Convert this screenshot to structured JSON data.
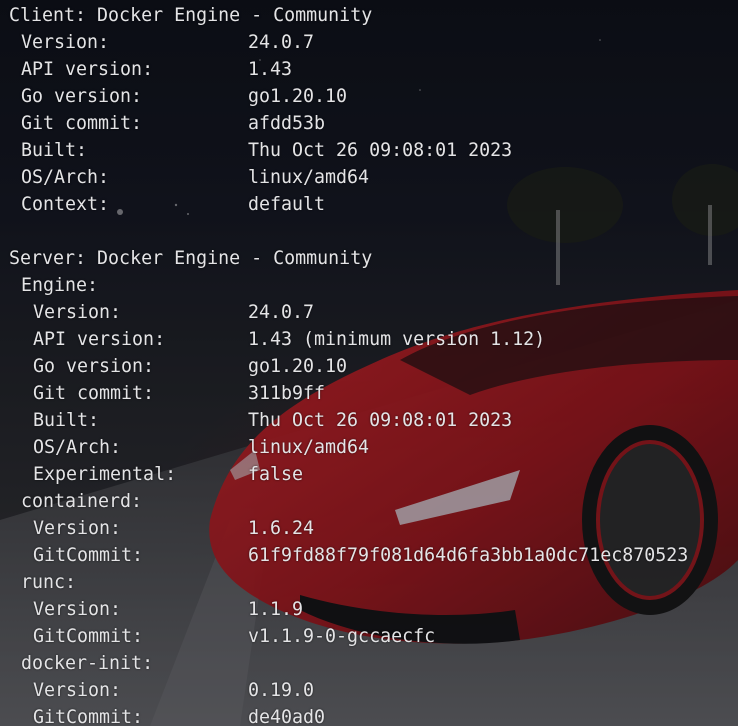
{
  "client": {
    "heading": "Client: Docker Engine - Community",
    "fields": [
      {
        "key": "Version:",
        "value": "24.0.7"
      },
      {
        "key": "API version:",
        "value": "1.43"
      },
      {
        "key": "Go version:",
        "value": "go1.20.10"
      },
      {
        "key": "Git commit:",
        "value": "afdd53b"
      },
      {
        "key": "Built:",
        "value": "Thu Oct 26 09:08:01 2023"
      },
      {
        "key": "OS/Arch:",
        "value": "linux/amd64"
      },
      {
        "key": "Context:",
        "value": "default"
      }
    ]
  },
  "server": {
    "heading": "Server: Docker Engine - Community",
    "engine": {
      "label": "Engine:",
      "fields": [
        {
          "key": "Version:",
          "value": "24.0.7"
        },
        {
          "key": "API version:",
          "value": "1.43 (minimum version 1.12)"
        },
        {
          "key": "Go version:",
          "value": "go1.20.10"
        },
        {
          "key": "Git commit:",
          "value": "311b9ff"
        },
        {
          "key": "Built:",
          "value": "Thu Oct 26 09:08:01 2023"
        },
        {
          "key": "OS/Arch:",
          "value": "linux/amd64"
        },
        {
          "key": "Experimental:",
          "value": "false"
        }
      ]
    },
    "containerd": {
      "label": "containerd:",
      "fields": [
        {
          "key": "Version:",
          "value": "1.6.24"
        },
        {
          "key": "GitCommit:",
          "value": "61f9fd88f79f081d64d6fa3bb1a0dc71ec870523"
        }
      ]
    },
    "runc": {
      "label": "runc:",
      "fields": [
        {
          "key": "Version:",
          "value": "1.1.9"
        },
        {
          "key": "GitCommit:",
          "value": "v1.1.9-0-gccaecfc"
        }
      ]
    },
    "docker_init": {
      "label": "docker-init:",
      "fields": [
        {
          "key": "Version:",
          "value": "0.19.0"
        },
        {
          "key": "GitCommit:",
          "value": "de40ad0"
        }
      ]
    }
  },
  "colors": {
    "text": "#e4e4e6",
    "car_red": "#b5161b"
  }
}
